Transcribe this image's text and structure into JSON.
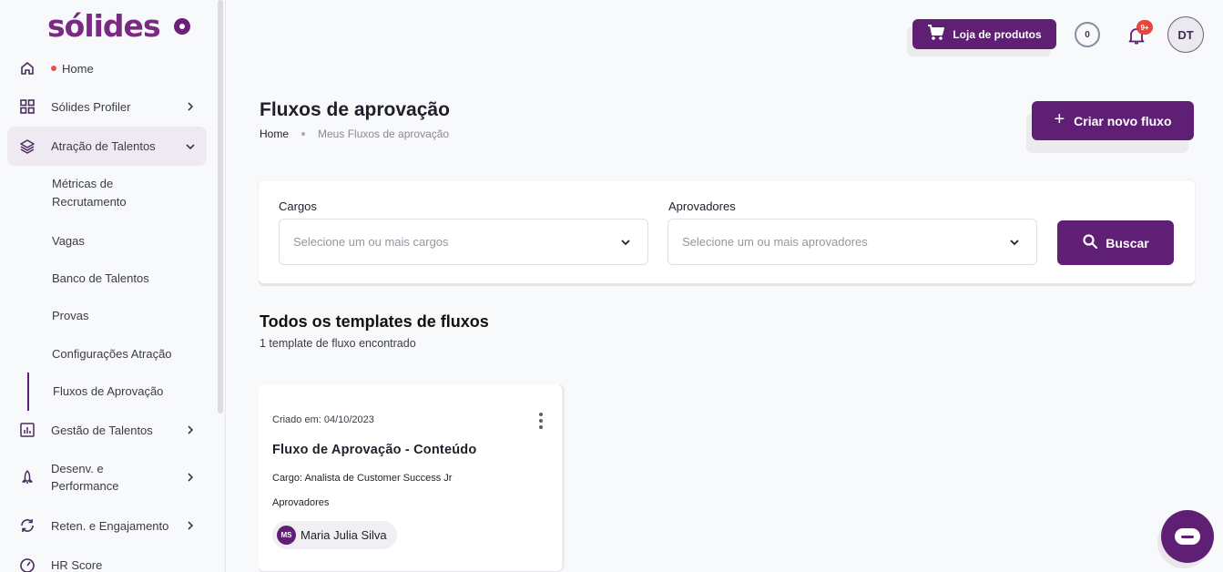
{
  "brand": {
    "logo_text": "sólides"
  },
  "sidebar": {
    "items": [
      {
        "label": "Home",
        "icon": "home-icon"
      },
      {
        "label": "Sólides Profiler",
        "icon": "grid-icon"
      },
      {
        "label": "Atração de Talentos",
        "icon": "layers-icon"
      },
      {
        "label": "Gestão de Talentos",
        "icon": "bar-chart-icon"
      },
      {
        "label": "Desenv. e Performance",
        "label_line1": "Desenv. e",
        "label_line2": "Performance",
        "icon": "rocket-icon"
      },
      {
        "label": "Reten. e Engajamento",
        "icon": "refresh-icon"
      },
      {
        "label": "HR Score",
        "icon": "gauge-icon"
      }
    ],
    "sub_items": [
      {
        "label_line1": "Métricas de",
        "label_line2": "Recrutamento"
      },
      {
        "label": "Vagas"
      },
      {
        "label": "Banco de Talentos"
      },
      {
        "label": "Provas"
      },
      {
        "label": "Configurações Atração"
      },
      {
        "label": "Fluxos de Aprovação"
      }
    ]
  },
  "header": {
    "shop_label": "Loja de produtos",
    "coins": "0",
    "notifications_badge": "9+",
    "avatar_initials": "DT"
  },
  "page": {
    "title": "Fluxos de aprovação",
    "breadcrumb": [
      "Home",
      "Meus Fluxos de aprovação"
    ],
    "create_label": "Criar novo fluxo"
  },
  "filters": {
    "cargos_label": "Cargos",
    "cargos_placeholder": "Selecione um ou mais cargos",
    "aprovadores_label": "Aprovadores",
    "aprovadores_placeholder": "Selecione um ou mais aprovadores",
    "search_label": "Buscar"
  },
  "templates": {
    "title": "Todos os templates de fluxos",
    "count_text": "1 template de fluxo encontrado",
    "items": [
      {
        "created": "Criado em: 04/10/2023",
        "name": "Fluxo de Aprovação - Conteúdo",
        "cargo": "Cargo: Analista de Customer Success Jr",
        "approvers_label": "Aprovadores",
        "approver": {
          "initials": "MS",
          "name": "Maria Julia Silva"
        }
      }
    ]
  },
  "colors": {
    "primary": "#5f1f74",
    "logo": "#7b2a83",
    "alert": "#e8453c",
    "background": "#f8f9fa"
  }
}
